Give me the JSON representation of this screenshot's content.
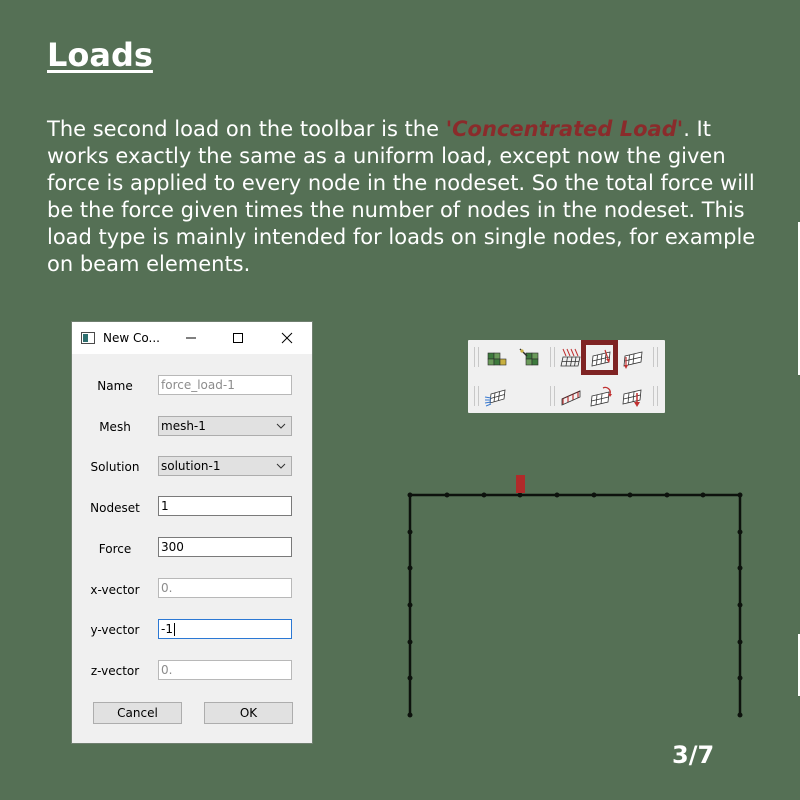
{
  "slide": {
    "title": "Loads",
    "body_before": "The second load on the toolbar is the ",
    "body_highlight": "'Concentrated Load'",
    "body_after": ". It works exactly the same as a uniform load, except now the given force is applied to every node in the nodeset. So the total force will be the force given times the number of nodes in the nodeset. This load type is mainly intended for loads on single nodes, for example on beam elements.",
    "page_number": "3/7",
    "highlight_color": "#8a2b2b",
    "background_color": "#557055"
  },
  "dialog": {
    "title": "New Co...",
    "fields": {
      "name": {
        "label": "Name",
        "placeholder": "force_load-1"
      },
      "mesh": {
        "label": "Mesh",
        "value": "mesh-1"
      },
      "solution": {
        "label": "Solution",
        "value": "solution-1"
      },
      "nodeset": {
        "label": "Nodeset",
        "value": "1"
      },
      "force": {
        "label": "Force",
        "value": "300"
      },
      "x_vector": {
        "label": "x-vector",
        "placeholder": "0."
      },
      "y_vector": {
        "label": "y-vector",
        "value": "-1"
      },
      "z_vector": {
        "label": "z-vector",
        "placeholder": "0."
      }
    },
    "buttons": {
      "cancel": "Cancel",
      "ok": "OK"
    }
  },
  "toolbar": {
    "row1_icons": [
      "mesh-element-icon",
      "mesh-node-icon",
      "uniform-load-icon",
      "concentrated-load-icon",
      "pressure-load-icon"
    ],
    "row2_icons": [
      "flow-load-icon",
      "distributed-load-icon",
      "moment-load-icon",
      "gravity-load-icon"
    ],
    "selected_icon": "concentrated-load-icon",
    "selected_color": "#7f2323"
  },
  "frame": {
    "load_marker_color": "#b02a2a"
  }
}
